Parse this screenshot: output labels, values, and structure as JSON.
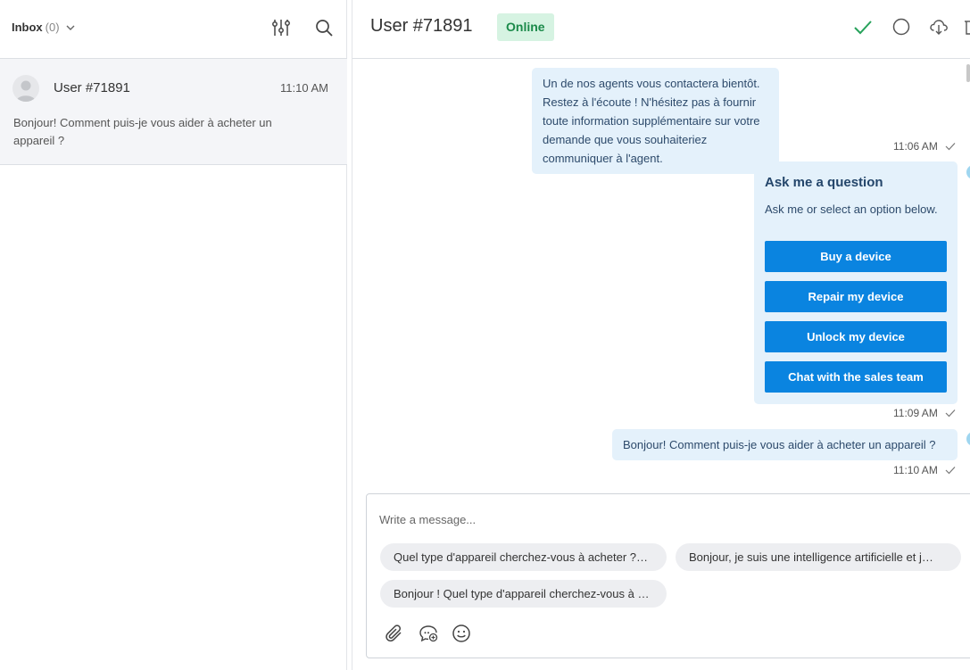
{
  "left_header": {
    "inbox_label": "Inbox",
    "inbox_count": "(0)",
    "icons": [
      "chevron-down-icon",
      "filter-sliders-icon",
      "search-icon"
    ]
  },
  "conversation": {
    "name": "User #71891",
    "time": "11:10 AM",
    "preview": "Bonjour! Comment puis-je vous aider à acheter un appareil ?"
  },
  "chat_header": {
    "title": "User #71891",
    "status": "Online",
    "icons": [
      "check-icon",
      "circle-icon",
      "cloud-download-icon"
    ]
  },
  "messages": [
    {
      "text": "Un de nos agents vous contactera bientôt. Restez à l'écoute ! N'hésitez pas à fournir toute information supplémentaire sur votre demande que vous souhaiteriez communiquer à l'agent.",
      "time": "11:06 AM"
    },
    {
      "card": {
        "title": "Ask me a question",
        "subtitle": "Ask me or select an option below.",
        "buttons": [
          "Buy a device",
          "Repair my device",
          "Unlock my device",
          "Chat with the sales team"
        ]
      },
      "time": "11:09 AM"
    },
    {
      "text": "Bonjour! Comment puis-je vous aider à acheter un appareil ?",
      "time": "11:10 AM"
    }
  ],
  "composer": {
    "placeholder": "Write a message...",
    "suggestions": [
      "Quel type d'appareil cherchez-vous à acheter ?…",
      "Bonjour, je suis une intelligence artificielle et j…",
      "Bonjour ! Quel type d'appareil cherchez-vous à …"
    ],
    "tools": [
      "paperclip-icon",
      "bot-chat-icon",
      "emoji-icon"
    ]
  },
  "colors": {
    "accent_blue": "#0a84e0",
    "bubble_bg": "#e4f1fb",
    "online_bg": "#d6f3e2",
    "online_text": "#1b8a4a",
    "check_green": "#27a25b"
  }
}
